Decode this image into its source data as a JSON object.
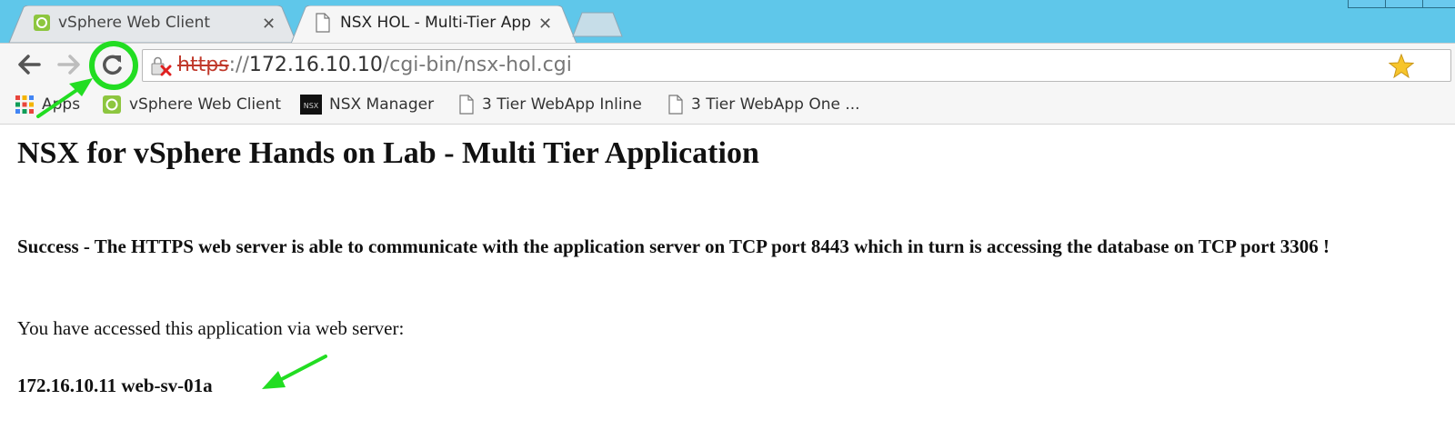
{
  "browser": {
    "tabs": [
      {
        "label": "vSphere Web Client",
        "active": false,
        "favicon": "vsphere-icon"
      },
      {
        "label": "NSX HOL - Multi-Tier App",
        "active": true,
        "favicon": "document-icon"
      }
    ],
    "address_bar": {
      "scheme": "https",
      "separator": "://",
      "host": "172.16.10.10",
      "path": "/cgi-bin/nsx-hol.cgi",
      "security_icon": "insecure-lock-icon"
    },
    "bookmarks": [
      {
        "label": "Apps",
        "icon": "apps-grid-icon"
      },
      {
        "label": "vSphere Web Client",
        "icon": "vsphere-icon"
      },
      {
        "label": "NSX Manager",
        "icon": "nsx-icon"
      },
      {
        "label": "3 Tier WebApp Inline",
        "icon": "document-icon"
      },
      {
        "label": "3 Tier WebApp One ...",
        "icon": "document-icon"
      }
    ]
  },
  "page": {
    "title": "NSX for vSphere Hands on Lab - Multi Tier Application",
    "success_message": "Success - The HTTPS web server is able to communicate with the application server on TCP port 8443 which in turn is accessing the database on TCP port 3306 !",
    "access_text": "You have accessed this application via web server:",
    "server_info": "172.16.10.11 web-sv-01a"
  },
  "annotations": {
    "highlight_color": "#22dd22"
  }
}
